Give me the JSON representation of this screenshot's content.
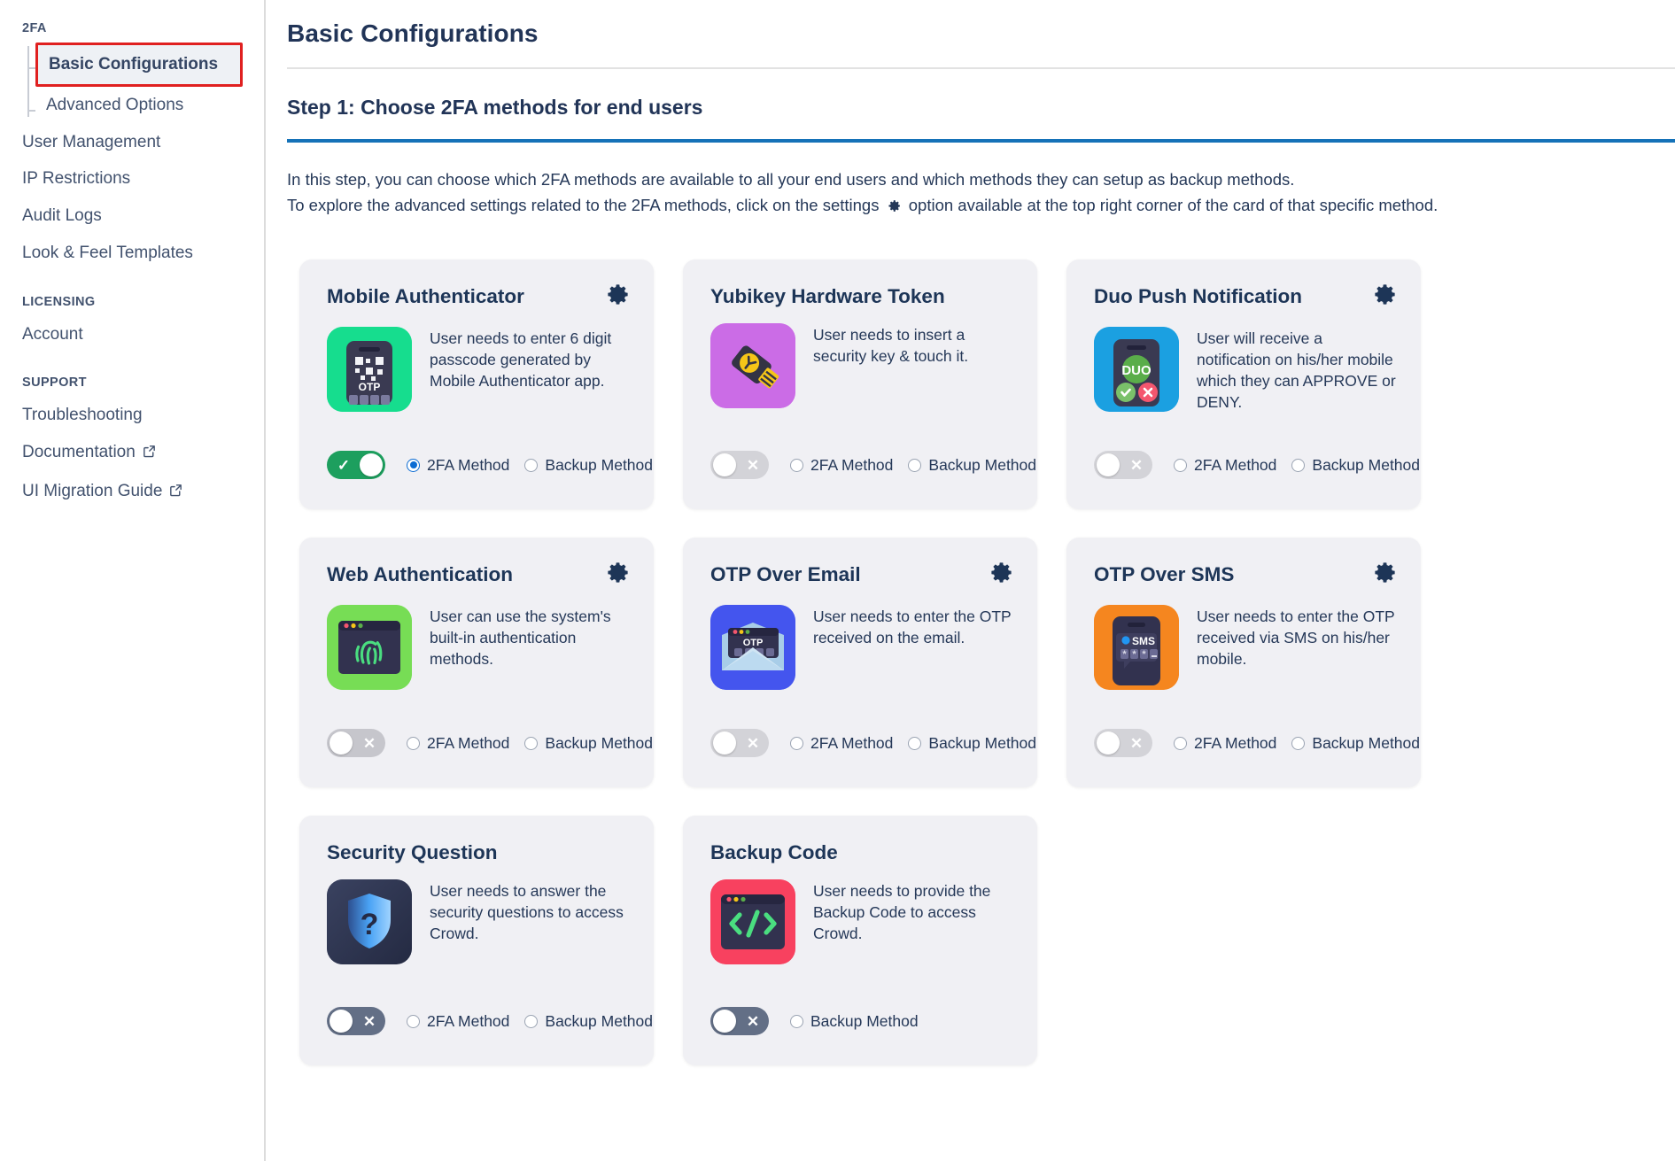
{
  "sidebar": {
    "sections": [
      {
        "label": "2FA",
        "items": [
          {
            "label": "Basic Configurations",
            "active": true,
            "sub": true
          },
          {
            "label": "Advanced Options",
            "active": false,
            "sub": true
          },
          {
            "label": "User Management",
            "active": false,
            "sub": false
          },
          {
            "label": "IP Restrictions",
            "active": false,
            "sub": false
          },
          {
            "label": "Audit Logs",
            "active": false,
            "sub": false
          },
          {
            "label": "Look & Feel Templates",
            "active": false,
            "sub": false
          }
        ]
      },
      {
        "label": "LICENSING",
        "items": [
          {
            "label": "Account",
            "active": false,
            "sub": false
          }
        ]
      },
      {
        "label": "SUPPORT",
        "items": [
          {
            "label": "Troubleshooting",
            "active": false,
            "sub": false,
            "external": false
          },
          {
            "label": "Documentation",
            "active": false,
            "sub": false,
            "external": true
          },
          {
            "label": "UI Migration Guide",
            "active": false,
            "sub": false,
            "external": true
          }
        ]
      }
    ]
  },
  "main": {
    "page_title": "Basic Configurations",
    "step_title": "Step 1: Choose 2FA methods for end users",
    "intro_line1": "In this step, you can choose which 2FA methods are available to all your end users and which methods they can setup as backup methods.",
    "intro_line2_before": "To explore the advanced settings related to the 2FA methods, click on the settings",
    "intro_line2_after": "option available at the top right corner of the card of that specific method."
  },
  "labels": {
    "method_2fa": "2FA Method",
    "method_backup": "Backup Method",
    "gear_icon": "gear-icon",
    "external_icon": "external-link-icon"
  },
  "colors": {
    "accent_blue": "#1572b8",
    "toggle_on": "#1d9f5e",
    "radio_selected": "#0b6bd3",
    "highlight_border": "#e02020",
    "card_bg": "#f0f0f4",
    "title": "#1d3557"
  },
  "cards": [
    {
      "id": "mobile-authenticator",
      "title": "Mobile Authenticator",
      "description": "User needs to enter 6 digit passcode generated by Mobile Authenticator app.",
      "icon_name": "mobile-otp-icon",
      "icon_bg": "#16dd8e",
      "has_gear": true,
      "toggle_state": "on",
      "toggle_style": "on",
      "toggle_mark": "✓",
      "radios": [
        {
          "label": "2FA Method",
          "selected": true
        },
        {
          "label": "Backup Method",
          "selected": false
        }
      ]
    },
    {
      "id": "yubikey-hardware-token",
      "title": "Yubikey Hardware Token",
      "description": "User needs to insert a security key & touch it.",
      "icon_name": "yubikey-usb-icon",
      "icon_bg": "#cb6ce6",
      "has_gear": false,
      "toggle_state": "off",
      "toggle_style": "off-light",
      "toggle_mark": "✕",
      "radios": [
        {
          "label": "2FA Method",
          "selected": false
        },
        {
          "label": "Backup Method",
          "selected": false
        }
      ]
    },
    {
      "id": "duo-push-notification",
      "title": "Duo Push Notification",
      "description": "User will receive a notification on his/her mobile which they can APPROVE or DENY.",
      "icon_name": "duo-push-phone-icon",
      "icon_bg": "#1ba0e1",
      "has_gear": true,
      "toggle_state": "off",
      "toggle_style": "off-light",
      "toggle_mark": "✕",
      "radios": [
        {
          "label": "2FA Method",
          "selected": false
        },
        {
          "label": "Backup Method",
          "selected": false
        }
      ]
    },
    {
      "id": "web-authentication",
      "title": "Web Authentication",
      "description": "User can use the system's built-in authentication methods.",
      "icon_name": "fingerprint-window-icon",
      "icon_bg": "#77dd55",
      "has_gear": true,
      "toggle_state": "off",
      "toggle_style": "off-mid",
      "toggle_mark": "✕",
      "radios": [
        {
          "label": "2FA Method",
          "selected": false
        },
        {
          "label": "Backup Method",
          "selected": false
        }
      ]
    },
    {
      "id": "otp-over-email",
      "title": "OTP Over Email",
      "description": "User needs to enter the OTP received on the email.",
      "icon_name": "email-otp-icon",
      "icon_bg": "#4455ee",
      "has_gear": true,
      "toggle_state": "off",
      "toggle_style": "off-light",
      "toggle_mark": "✕",
      "radios": [
        {
          "label": "2FA Method",
          "selected": false
        },
        {
          "label": "Backup Method",
          "selected": false
        }
      ]
    },
    {
      "id": "otp-over-sms",
      "title": "OTP Over SMS",
      "description": "User needs to enter the OTP received via SMS on his/her mobile.",
      "icon_name": "sms-otp-icon",
      "icon_bg": "#f5861f",
      "has_gear": true,
      "toggle_state": "off",
      "toggle_style": "off-light",
      "toggle_mark": "✕",
      "radios": [
        {
          "label": "2FA Method",
          "selected": false
        },
        {
          "label": "Backup Method",
          "selected": false
        }
      ]
    },
    {
      "id": "security-question",
      "title": "Security Question",
      "description": "User needs to answer the security questions to access Crowd.",
      "icon_name": "shield-question-icon",
      "icon_bg": "#2a3250",
      "has_gear": false,
      "toggle_state": "off",
      "toggle_style": "off-dark",
      "toggle_mark": "✕",
      "radios": [
        {
          "label": "2FA Method",
          "selected": false
        },
        {
          "label": "Backup Method",
          "selected": false
        }
      ]
    },
    {
      "id": "backup-code",
      "title": "Backup Code",
      "description": "User needs to provide the Backup Code to access Crowd.",
      "icon_name": "code-window-icon",
      "icon_bg": "#f8415f",
      "has_gear": false,
      "toggle_state": "off",
      "toggle_style": "off-dark",
      "toggle_mark": "✕",
      "radios": [
        {
          "label": "Backup Method",
          "selected": false
        }
      ]
    }
  ]
}
